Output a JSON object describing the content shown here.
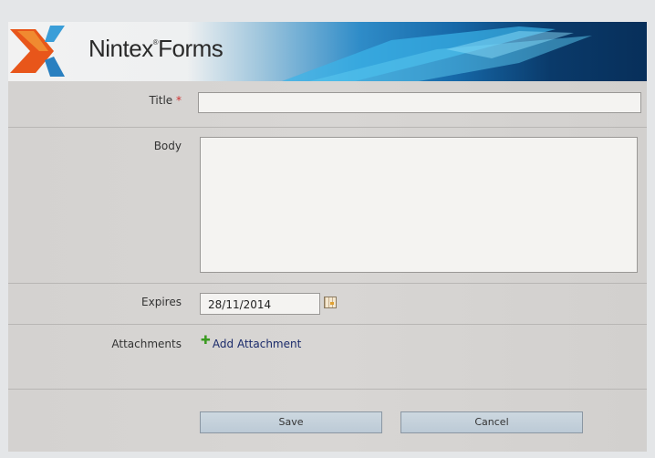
{
  "header": {
    "logo_text": "Nintex",
    "logo_reg": "®",
    "logo_text2": "Forms"
  },
  "form": {
    "title": {
      "label": "Title",
      "required_mark": "*",
      "value": ""
    },
    "body": {
      "label": "Body",
      "value": ""
    },
    "expires": {
      "label": "Expires",
      "value": "28/11/2014",
      "icon": "calendar-icon"
    },
    "attachments": {
      "label": "Attachments",
      "add_label": "Add Attachment",
      "icon": "plus-icon"
    }
  },
  "buttons": {
    "save": "Save",
    "cancel": "Cancel"
  },
  "colors": {
    "required": "#d03030",
    "link": "#1a2a6a",
    "banner_dark": "#072f5a"
  }
}
